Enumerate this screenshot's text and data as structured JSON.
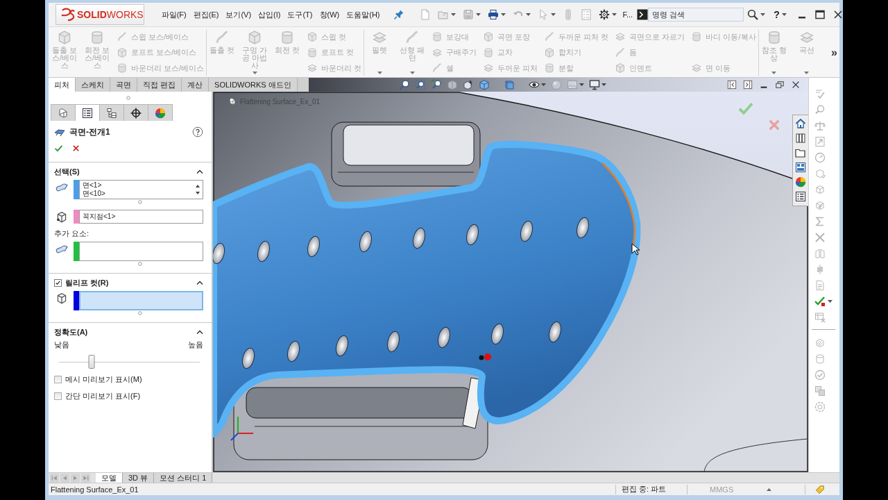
{
  "menu_bar": {
    "logo": "**SOLID**WORKS",
    "menus": [
      "파일(F)",
      "편집(E)",
      "보기(V)",
      "삽입(I)",
      "도구(T)",
      "창(W)",
      "도움말(H)"
    ],
    "truncated_label": "F...",
    "search": {
      "placeholder": "명령 검색"
    },
    "help": "?"
  },
  "command_manager": {
    "disabled": true,
    "groups": [
      {
        "large": [
          {
            "label": "돌출 보스/베이스",
            "dropdown": false
          },
          {
            "label": "회전 보스/베이스",
            "dropdown": false
          }
        ],
        "small_columns": [
          [
            "스윕 보스/베이스",
            "로프트 보스/베이스",
            "바운더리 보스/베이스"
          ]
        ]
      },
      {
        "large": [
          {
            "label": "돌출 컷",
            "dropdown": false
          },
          {
            "label": "구멍 가공 마법사",
            "dropdown": true
          },
          {
            "label": "회전 컷",
            "dropdown": false
          }
        ],
        "small_columns": [
          [
            "스윕 컷",
            "로프트 컷",
            "바운더리 컷"
          ]
        ]
      },
      {
        "large": [
          {
            "label": "필렛",
            "dropdown": true
          },
          {
            "label": "선형 패턴",
            "dropdown": true
          }
        ],
        "small_columns": [
          [
            "보강대",
            "구배주기",
            "쉘"
          ],
          [
            "곡면 포장",
            "교차",
            "두꺼운 피처"
          ],
          [
            "두꺼운 피처 컷",
            "합치기",
            "분할"
          ],
          [
            "곡면으로 자르기",
            "돔",
            "인덴트"
          ],
          [
            "바디 이동/복사",
            "면 이동"
          ]
        ]
      },
      {
        "large": [
          {
            "label": "참조 형상",
            "dropdown": true
          },
          {
            "label": "곡선",
            "dropdown": true
          }
        ]
      }
    ],
    "overflow": "»"
  },
  "command_tabs": [
    {
      "label": "피처",
      "selected": true
    },
    {
      "label": "스케치",
      "selected": false
    },
    {
      "label": "곡면",
      "selected": false
    },
    {
      "label": "직접 편집",
      "selected": false
    },
    {
      "label": "계산",
      "selected": false
    },
    {
      "label": "SOLIDWORKS 애드인",
      "selected": false
    }
  ],
  "property_manager": {
    "tabs": [
      {
        "selected": false
      },
      {
        "selected": true
      },
      {
        "selected": false
      },
      {
        "selected": false
      },
      {
        "selected": false
      }
    ],
    "title": "곡면-전개1",
    "sections": [
      {
        "kind": "selection",
        "title": "선택(S)",
        "expanded": true,
        "items": [
          {
            "kind": "list",
            "color": "#4a9eea",
            "active": false,
            "entries": [
              "면<1>",
              "면<10>"
            ]
          },
          {
            "kind": "list",
            "color": "#f08ac0",
            "active": false,
            "entries": [
              "꼭지점<1>"
            ]
          },
          {
            "kind": "label",
            "text": "추가 요소:"
          },
          {
            "kind": "list",
            "color": "#22c040",
            "active": false
          }
        ]
      },
      {
        "kind": "optional_selection",
        "title": "릴리프 컷(R)",
        "checked": true,
        "expanded": true,
        "items": [
          {
            "kind": "list",
            "color": "#0000e0",
            "active": true
          }
        ]
      },
      {
        "kind": "accuracy",
        "title": "정확도(A)",
        "expanded": true,
        "low": "낮음",
        "high": "높음",
        "level": 0.23,
        "options": [
          {
            "label": "메시 미리보기 표시(M)",
            "checked": false
          },
          {
            "label": "간단 미리보기 표시(F)",
            "checked": false
          }
        ]
      }
    ]
  },
  "graphics": {
    "tree_flyout": "Flattening Surface_Ex_01"
  },
  "bottom_tabs": [
    {
      "label": "모델",
      "selected": true
    },
    {
      "label": "3D 뷰",
      "selected": false
    },
    {
      "label": "모션 스터디 1",
      "selected": false
    }
  ],
  "status_bar": {
    "document": "Flattening Surface_Ex_01",
    "mode": "편집 중: 파트",
    "units": "MMGS"
  }
}
